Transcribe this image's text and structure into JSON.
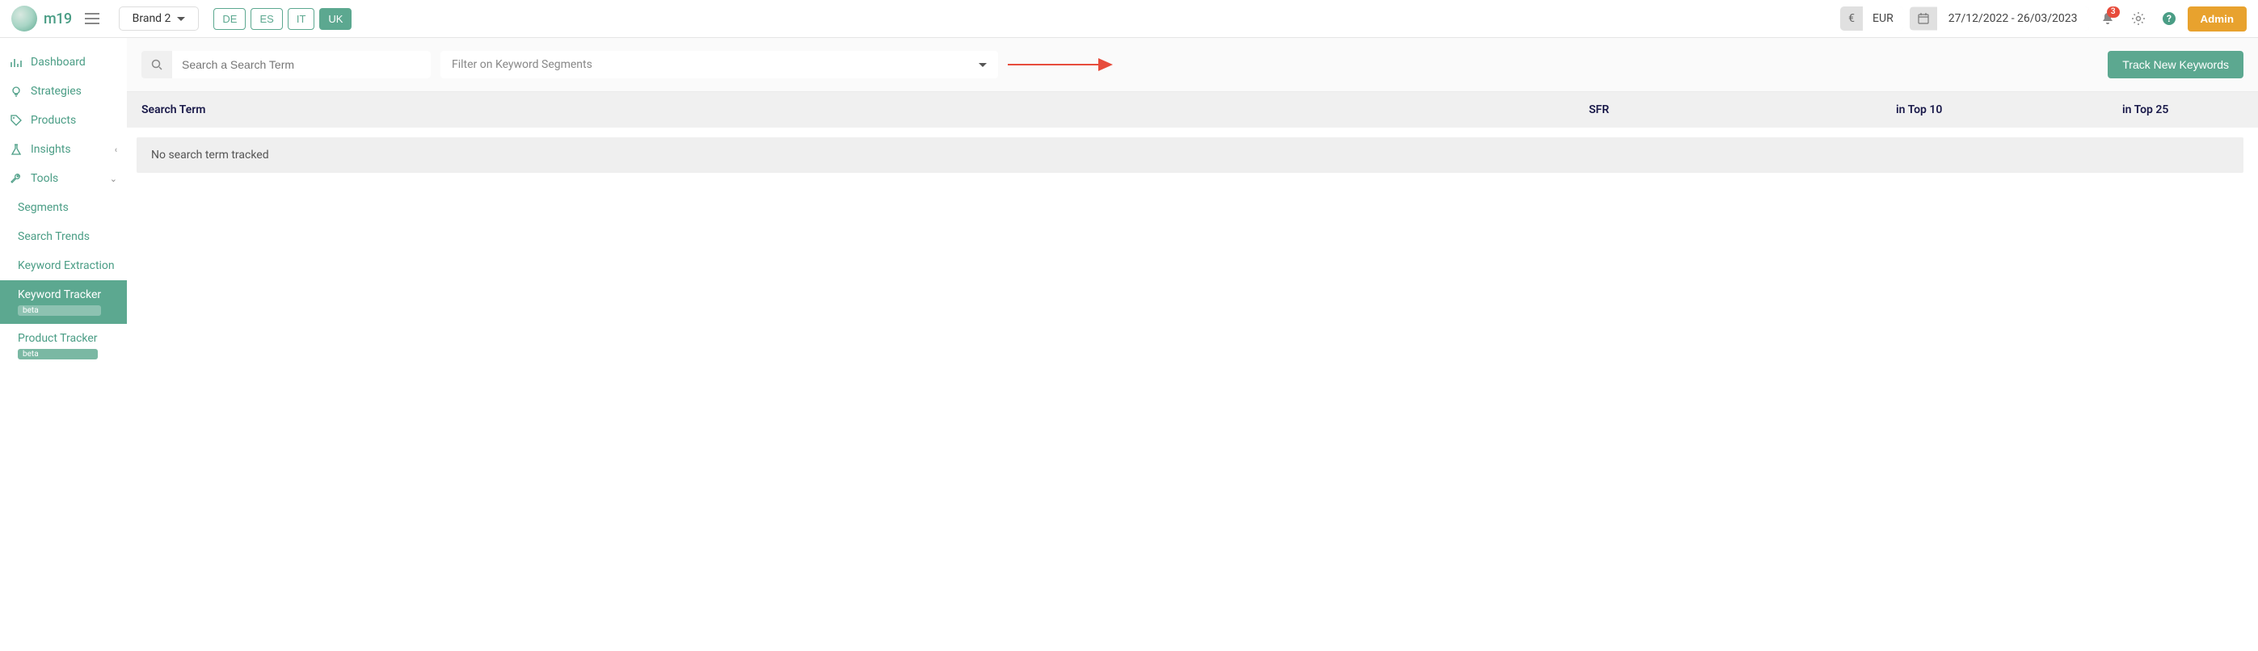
{
  "header": {
    "logo_text": "m19",
    "brand_selector": "Brand 2",
    "locales": [
      "DE",
      "ES",
      "IT",
      "UK"
    ],
    "locale_active_index": 3,
    "currency_symbol": "€",
    "currency_code": "EUR",
    "date_range": "27/12/2022 - 26/03/2023",
    "notification_count": "3",
    "admin_label": "Admin"
  },
  "sidebar": {
    "items": [
      {
        "label": "Dashboard",
        "icon": "bar-chart"
      },
      {
        "label": "Strategies",
        "icon": "bulb"
      },
      {
        "label": "Products",
        "icon": "tag"
      },
      {
        "label": "Insights",
        "icon": "flask",
        "chev": "‹"
      },
      {
        "label": "Tools",
        "icon": "wrench",
        "chev": "⌄"
      }
    ],
    "sub_items": [
      {
        "label": "Segments"
      },
      {
        "label": "Search Trends"
      },
      {
        "label": "Keyword Extraction"
      },
      {
        "label": "Keyword Tracker",
        "beta": "beta",
        "active": true
      },
      {
        "label": "Product Tracker",
        "beta": "beta"
      }
    ]
  },
  "toolbar": {
    "search_placeholder": "Search a Search Term",
    "filter_placeholder": "Filter on Keyword Segments",
    "track_btn": "Track New Keywords"
  },
  "table": {
    "columns": [
      "Search Term",
      "SFR",
      "in Top 10",
      "in Top 25"
    ],
    "empty_message": "No search term tracked"
  },
  "colors": {
    "primary": "#5ca890",
    "accent": "#e8a22e",
    "danger": "#e74c3c",
    "heading": "#1a1a4a"
  }
}
